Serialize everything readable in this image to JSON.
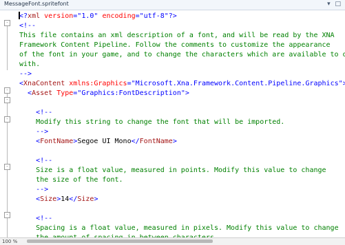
{
  "window": {
    "title": "MessageFont.spritefont",
    "controls": [
      "▾",
      "□"
    ]
  },
  "editor": {
    "lines": [
      {
        "parts": [
          {
            "cls": "b",
            "text": "<?"
          },
          {
            "cls": "t",
            "text": "xml"
          },
          {
            "cls": "a",
            "text": " version"
          },
          {
            "cls": "b",
            "text": "=\""
          },
          {
            "cls": "s",
            "text": "1.0"
          },
          {
            "cls": "b",
            "text": "\""
          },
          {
            "cls": "a",
            "text": " encoding"
          },
          {
            "cls": "b",
            "text": "=\""
          },
          {
            "cls": "s",
            "text": "utf-8"
          },
          {
            "cls": "b",
            "text": "\"?>"
          }
        ]
      },
      {
        "parts": [
          {
            "cls": "b",
            "text": "<!--"
          }
        ]
      },
      {
        "parts": [
          {
            "cls": "c",
            "text": "This file contains an xml description of a font, and will be read by the XNA"
          }
        ]
      },
      {
        "parts": [
          {
            "cls": "c",
            "text": "Framework Content Pipeline. Follow the comments to customize the appearance"
          }
        ]
      },
      {
        "parts": [
          {
            "cls": "c",
            "text": "of the font in your game, and to change the characters which are available to dr"
          }
        ]
      },
      {
        "parts": [
          {
            "cls": "c",
            "text": "with."
          }
        ]
      },
      {
        "parts": [
          {
            "cls": "b",
            "text": "-->"
          }
        ]
      },
      {
        "parts": [
          {
            "cls": "b",
            "text": "<"
          },
          {
            "cls": "t",
            "text": "XnaContent"
          },
          {
            "cls": "a",
            "text": " xmlns:Graphics"
          },
          {
            "cls": "b",
            "text": "=\""
          },
          {
            "cls": "s",
            "text": "Microsoft.Xna.Framework.Content.Pipeline.Graphics"
          },
          {
            "cls": "b",
            "text": "\">"
          }
        ]
      },
      {
        "parts": [
          {
            "cls": "x",
            "text": "  "
          },
          {
            "cls": "b",
            "text": "<"
          },
          {
            "cls": "t",
            "text": "Asset"
          },
          {
            "cls": "a",
            "text": " Type"
          },
          {
            "cls": "b",
            "text": "=\""
          },
          {
            "cls": "s",
            "text": "Graphics:FontDescription"
          },
          {
            "cls": "b",
            "text": "\">"
          }
        ]
      },
      {
        "parts": [
          {
            "cls": "x",
            "text": ""
          }
        ]
      },
      {
        "parts": [
          {
            "cls": "x",
            "text": "    "
          },
          {
            "cls": "b",
            "text": "<!--"
          }
        ]
      },
      {
        "parts": [
          {
            "cls": "x",
            "text": "    "
          },
          {
            "cls": "c",
            "text": "Modify this string to change the font that will be imported."
          }
        ]
      },
      {
        "parts": [
          {
            "cls": "x",
            "text": "    "
          },
          {
            "cls": "b",
            "text": "-->"
          }
        ]
      },
      {
        "parts": [
          {
            "cls": "x",
            "text": "    "
          },
          {
            "cls": "b",
            "text": "<"
          },
          {
            "cls": "t",
            "text": "FontName"
          },
          {
            "cls": "b",
            "text": ">"
          },
          {
            "cls": "x",
            "text": "Segoe UI Mono"
          },
          {
            "cls": "b",
            "text": "</"
          },
          {
            "cls": "t",
            "text": "FontName"
          },
          {
            "cls": "b",
            "text": ">"
          }
        ]
      },
      {
        "parts": [
          {
            "cls": "x",
            "text": ""
          }
        ]
      },
      {
        "parts": [
          {
            "cls": "x",
            "text": "    "
          },
          {
            "cls": "b",
            "text": "<!--"
          }
        ]
      },
      {
        "parts": [
          {
            "cls": "x",
            "text": "    "
          },
          {
            "cls": "c",
            "text": "Size is a float value, measured in points. Modify this value to change"
          }
        ]
      },
      {
        "parts": [
          {
            "cls": "x",
            "text": "    "
          },
          {
            "cls": "c",
            "text": "the size of the font."
          }
        ]
      },
      {
        "parts": [
          {
            "cls": "x",
            "text": "    "
          },
          {
            "cls": "b",
            "text": "-->"
          }
        ]
      },
      {
        "parts": [
          {
            "cls": "x",
            "text": "    "
          },
          {
            "cls": "b",
            "text": "<"
          },
          {
            "cls": "t",
            "text": "Size"
          },
          {
            "cls": "b",
            "text": ">"
          },
          {
            "cls": "x",
            "text": "14"
          },
          {
            "cls": "b",
            "text": "</"
          },
          {
            "cls": "t",
            "text": "Size"
          },
          {
            "cls": "b",
            "text": ">"
          }
        ]
      },
      {
        "parts": [
          {
            "cls": "x",
            "text": ""
          }
        ]
      },
      {
        "parts": [
          {
            "cls": "x",
            "text": "    "
          },
          {
            "cls": "b",
            "text": "<!--"
          }
        ]
      },
      {
        "parts": [
          {
            "cls": "x",
            "text": "    "
          },
          {
            "cls": "c",
            "text": "Spacing is a float value, measured in pixels. Modify this value to change"
          }
        ]
      },
      {
        "parts": [
          {
            "cls": "x",
            "text": "    "
          },
          {
            "cls": "c",
            "text": "the amount of spacing in between characters."
          }
        ]
      }
    ]
  },
  "status": {
    "zoom": "100 %"
  }
}
